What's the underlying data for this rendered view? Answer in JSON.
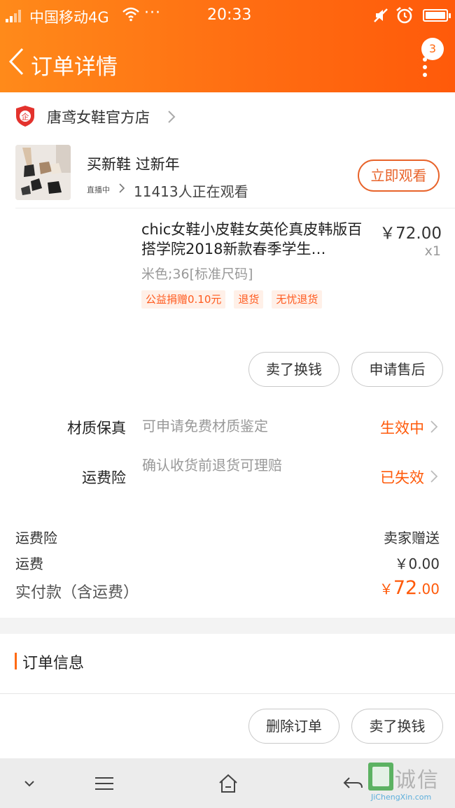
{
  "status_bar": {
    "carrier": "中国移动4G",
    "dots": "···",
    "time": "20:33"
  },
  "header": {
    "title": "订单详情",
    "badge_count": "3"
  },
  "shop": {
    "name": "唐鸢女鞋官方店",
    "logo_text": "企"
  },
  "live": {
    "headline": "买新鞋 过新年",
    "tag": "直播中",
    "viewers": "11413人正在观看",
    "watch_button": "立即观看"
  },
  "item": {
    "name": "chic女鞋小皮鞋女英伦真皮韩版百搭学院2018新款春季学生…",
    "price": "￥72.00",
    "quantity": "x1",
    "sku": "米色;36[标准尺码]",
    "tags": [
      "公益捐赠0.10元",
      "退货",
      "无忧退货"
    ]
  },
  "item_actions": {
    "sell_button": "卖了换钱",
    "after_sale_button": "申请售后"
  },
  "services": [
    {
      "label": "材质保真",
      "desc": "可申请免费材质鉴定",
      "state": "生效中"
    },
    {
      "label": "运费险",
      "desc": "确认收货前退货可理赔",
      "state": "已失效"
    }
  ],
  "summary": {
    "insurance_label": "运费险",
    "insurance_value": "卖家赠送",
    "shipping_label": "运费",
    "shipping_value": "￥0.00",
    "total_label": "实付款（含运费）",
    "total_currency": "￥",
    "total_int": "72",
    "total_dec": ".00"
  },
  "order_info": {
    "title": "订单信息"
  },
  "bottom_actions": {
    "delete_button": "删除订单",
    "sell_button": "卖了换钱"
  },
  "watermark": {
    "text": "诚信",
    "sub": "JiChengXin.com"
  },
  "colors": {
    "accent": "#ff6a13",
    "price_accent": "#ff5a0a"
  }
}
